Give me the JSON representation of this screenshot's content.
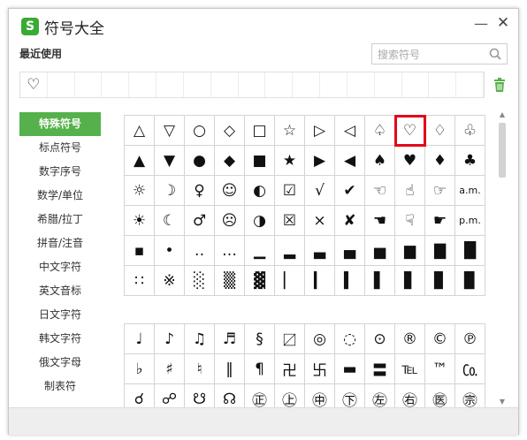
{
  "window": {
    "title": "符号大全",
    "logo": "S",
    "minimize": "—",
    "close": "✕"
  },
  "recent": {
    "label": "最近使用",
    "items": [
      "♡",
      "",
      "",
      "",
      "",
      "",
      "",
      "",
      "",
      "",
      "",
      "",
      "",
      "",
      "",
      "",
      ""
    ]
  },
  "search": {
    "placeholder": "搜索符号"
  },
  "sidebar": {
    "items": [
      {
        "label": "特殊符号",
        "active": true
      },
      {
        "label": "标点符号"
      },
      {
        "label": "数字序号"
      },
      {
        "label": "数学/单位"
      },
      {
        "label": "希腊/拉丁"
      },
      {
        "label": "拼音/注音"
      },
      {
        "label": "中文字符"
      },
      {
        "label": "英文音标"
      },
      {
        "label": "日文字符"
      },
      {
        "label": "韩文字符"
      },
      {
        "label": "俄文字母"
      },
      {
        "label": "制表符"
      }
    ]
  },
  "grid1": [
    [
      "△",
      "▽",
      "○",
      "◇",
      "□",
      "☆",
      "▷",
      "◁",
      "♤",
      "♡",
      "♢",
      "♧"
    ],
    [
      "▲",
      "▼",
      "●",
      "◆",
      "■",
      "★",
      "▶",
      "◀",
      "♠",
      "♥",
      "♦",
      "♣"
    ],
    [
      "☼",
      "☽",
      "♀",
      "☺",
      "◐",
      "☑",
      "√",
      "✔",
      "☜",
      "☝",
      "☞",
      "a.m."
    ],
    [
      "☀",
      "☾",
      "♂",
      "☹",
      "◑",
      "☒",
      "×",
      "✘",
      "☚",
      "☟",
      "☛",
      "p.m."
    ],
    [
      "▪",
      "•",
      "‥",
      "…",
      "▁",
      "▂",
      "▃",
      "▄",
      "▅",
      "▆",
      "▇",
      "█"
    ],
    [
      "∷",
      "※",
      "░",
      "▒",
      "▓",
      "▏",
      "▎",
      "▍",
      "▌",
      "▋",
      "▊",
      "▉"
    ]
  ],
  "grid2": [
    [
      "♩",
      "♪",
      "♫",
      "♬",
      "§",
      "〼",
      "◎",
      "◌",
      "⊙",
      "®",
      "©",
      "℗"
    ],
    [
      "♭",
      "♯",
      "♮",
      "‖",
      "¶",
      "卍",
      "卐",
      "▬",
      "〓",
      "℡",
      "™",
      "㏇"
    ],
    [
      "☌",
      "☍",
      "☋",
      "☊",
      "㊣",
      "㊤",
      "㊥",
      "㊦",
      "㊧",
      "㊨",
      "㊩",
      "㊪"
    ]
  ],
  "colors": {
    "accent": "#55b14b",
    "selection": "#e3071a",
    "logo": "#3aaa35"
  },
  "icons": {
    "search": "search-icon",
    "trash": "trash-icon",
    "logo": "sogou-logo-icon"
  }
}
